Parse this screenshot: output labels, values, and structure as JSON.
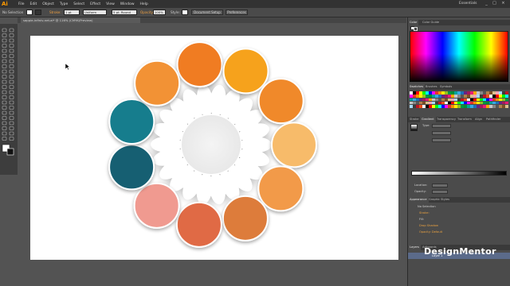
{
  "app": {
    "logo": "Ai",
    "menu": [
      "File",
      "Edit",
      "Object",
      "Type",
      "Select",
      "Effect",
      "View",
      "Window",
      "Help"
    ],
    "workspace": "Essentials",
    "window_controls": [
      "_",
      "□",
      "×"
    ]
  },
  "controlbar": {
    "selection_label": "No Selection",
    "stroke_label": "Stroke:",
    "stroke_weight": "1 pt",
    "stroke_profile": "Uniform",
    "brush": "5 pt. Round",
    "opacity_label": "Opacity:",
    "opacity_value": "100%",
    "style_label": "Style:",
    "document_setup_button": "Document Setup",
    "preferences_button": "Preferences"
  },
  "document": {
    "tab_label": "sapple-infiniv-net.ai* @ 116% (CMYK/Preview)"
  },
  "panels": {
    "color_tabs": [
      "Color",
      "Color Guide"
    ],
    "swatches_tabs": [
      "Swatches",
      "Brushes",
      "Symbols"
    ],
    "gradient_tabs": [
      "Stroke",
      "Gradient",
      "Transparency",
      "Transform",
      "Align",
      "Pathfinder"
    ],
    "gradient_type_label": "Type:",
    "gradient_fields": [
      "Location:",
      "Opacity:"
    ],
    "appearance_tabs": [
      "Appearance",
      "Graphic Styles"
    ],
    "appearance_title": "No Selection",
    "appearance_rows": [
      "Stroke:",
      "Fill:",
      "Drop Shadow",
      "Opacity: Default"
    ],
    "layers_tabs": [
      "Layers",
      "Artboards"
    ],
    "layer_name": "Layer 1"
  },
  "colors": {
    "accent": "#ff9a00",
    "circles": [
      "#f07b24",
      "#f6a21b",
      "#f0892b",
      "#f7bb6a",
      "#f29a4a",
      "#dd7b3a",
      "#e06a45",
      "#f09a90",
      "#165e72",
      "#177d8d",
      "#f29235"
    ]
  },
  "watermark": "DesignMentor"
}
